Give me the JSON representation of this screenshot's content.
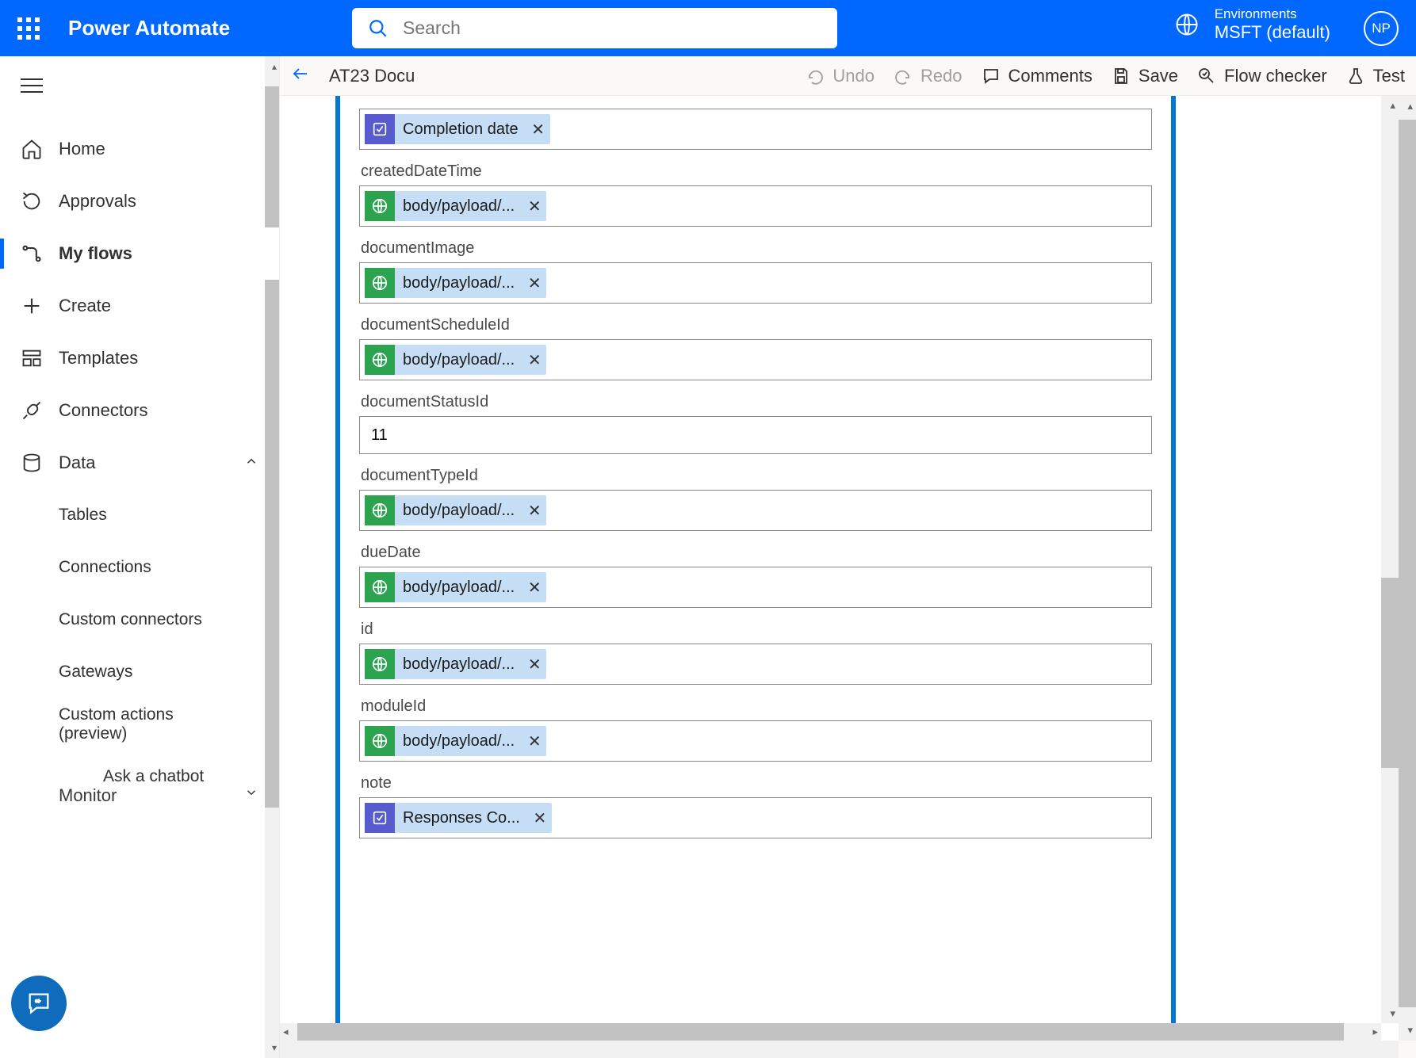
{
  "header": {
    "brand": "Power Automate",
    "search_placeholder": "Search",
    "env_label": "Environments",
    "env_value": "MSFT (default)",
    "avatar_initials": "NP"
  },
  "nav": {
    "items": [
      {
        "icon": "home",
        "label": "Home"
      },
      {
        "icon": "approvals",
        "label": "Approvals"
      },
      {
        "icon": "flows",
        "label": "My flows",
        "selected": true
      },
      {
        "icon": "create",
        "label": "Create"
      },
      {
        "icon": "templates",
        "label": "Templates"
      },
      {
        "icon": "connectors",
        "label": "Connectors"
      },
      {
        "icon": "data",
        "label": "Data",
        "expanded": true,
        "children": [
          {
            "label": "Tables"
          },
          {
            "label": "Connections"
          },
          {
            "label": "Custom connectors"
          },
          {
            "label": "Gateways"
          },
          {
            "label": "Custom actions (preview)"
          }
        ]
      },
      {
        "icon": "monitor",
        "label": "Monitor",
        "expanded": false
      }
    ],
    "ask_chatbot": "Ask a chatbot"
  },
  "cmdbar": {
    "title": "AT23 Docu",
    "undo": "Undo",
    "redo": "Redo",
    "comments": "Comments",
    "save": "Save",
    "flow_checker": "Flow checker",
    "test": "Test"
  },
  "fields": [
    {
      "label": null,
      "token": {
        "badge": "purple",
        "text": "Completion date"
      }
    },
    {
      "label": "createdDateTime",
      "token": {
        "badge": "green",
        "text": "body/payload/..."
      }
    },
    {
      "label": "documentImage",
      "token": {
        "badge": "green",
        "text": "body/payload/..."
      }
    },
    {
      "label": "documentScheduleId",
      "token": {
        "badge": "green",
        "text": "body/payload/..."
      }
    },
    {
      "label": "documentStatusId",
      "value": "11"
    },
    {
      "label": "documentTypeId",
      "token": {
        "badge": "green",
        "text": "body/payload/..."
      }
    },
    {
      "label": "dueDate",
      "token": {
        "badge": "green",
        "text": "body/payload/..."
      }
    },
    {
      "label": "id",
      "token": {
        "badge": "green",
        "text": "body/payload/..."
      }
    },
    {
      "label": "moduleId",
      "token": {
        "badge": "green",
        "text": "body/payload/..."
      }
    },
    {
      "label": "note",
      "token": {
        "badge": "purple",
        "text": "Responses Co..."
      }
    }
  ]
}
